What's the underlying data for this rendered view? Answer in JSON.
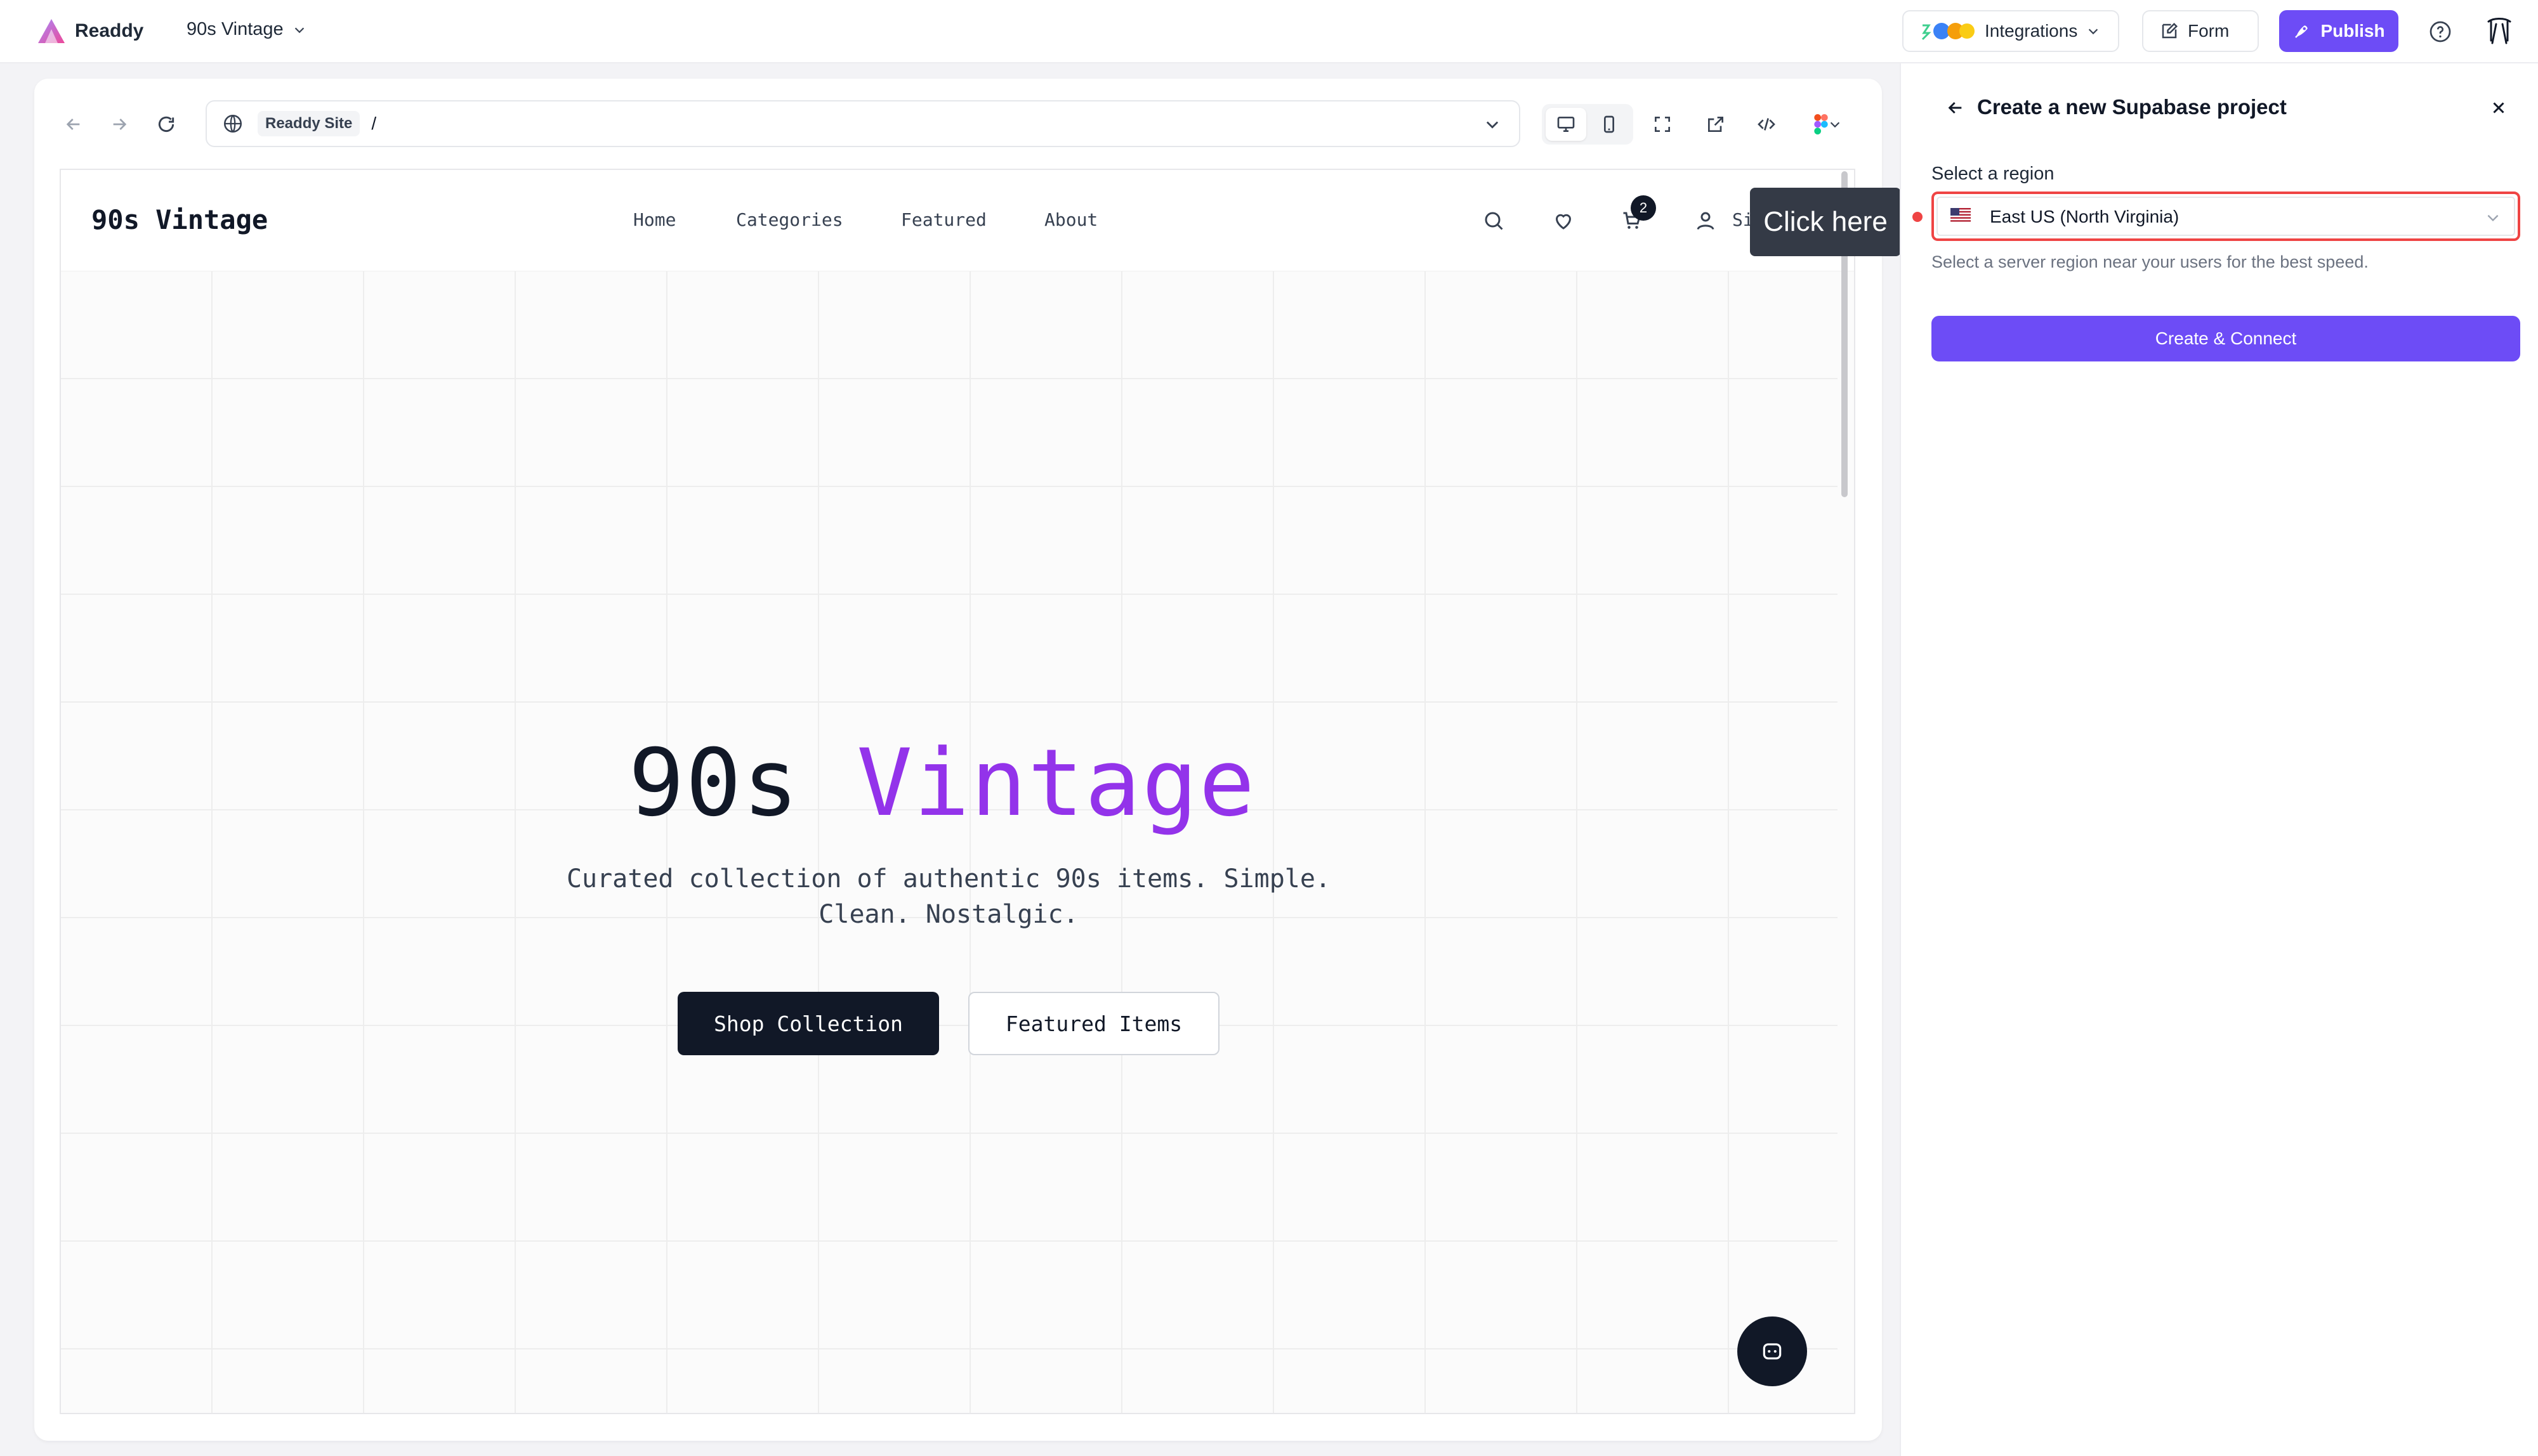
{
  "app": {
    "brand": "Readdy",
    "project_name": "90s Vintage"
  },
  "toolbar": {
    "integrations_label": "Integrations",
    "form_label": "Form",
    "publish_label": "Publish"
  },
  "browser": {
    "site_chip": "Readdy Site",
    "path": "/"
  },
  "site": {
    "logo": "90s Vintage",
    "nav": [
      "Home",
      "Categories",
      "Featured",
      "About"
    ],
    "cart_count": "2",
    "signin_partial": "Si",
    "hero_title_main": "90s",
    "hero_title_accent": "Vintage",
    "hero_subtitle": "Curated collection of authentic 90s items. Simple. Clean. Nostalgic.",
    "primary_cta": "Shop Collection",
    "secondary_cta": "Featured Items"
  },
  "tooltip": {
    "text": "Click here"
  },
  "panel": {
    "title": "Create a new Supabase project",
    "region_label": "Select a region",
    "region_value": "East US (North Virginia)",
    "region_helper": "Select a server region near your users for the best speed.",
    "submit_label": "Create & Connect"
  },
  "colors": {
    "accent": "#6d4cf6",
    "hero_accent": "#9333ea",
    "highlight_border": "#ef4444",
    "dark": "#111827"
  }
}
